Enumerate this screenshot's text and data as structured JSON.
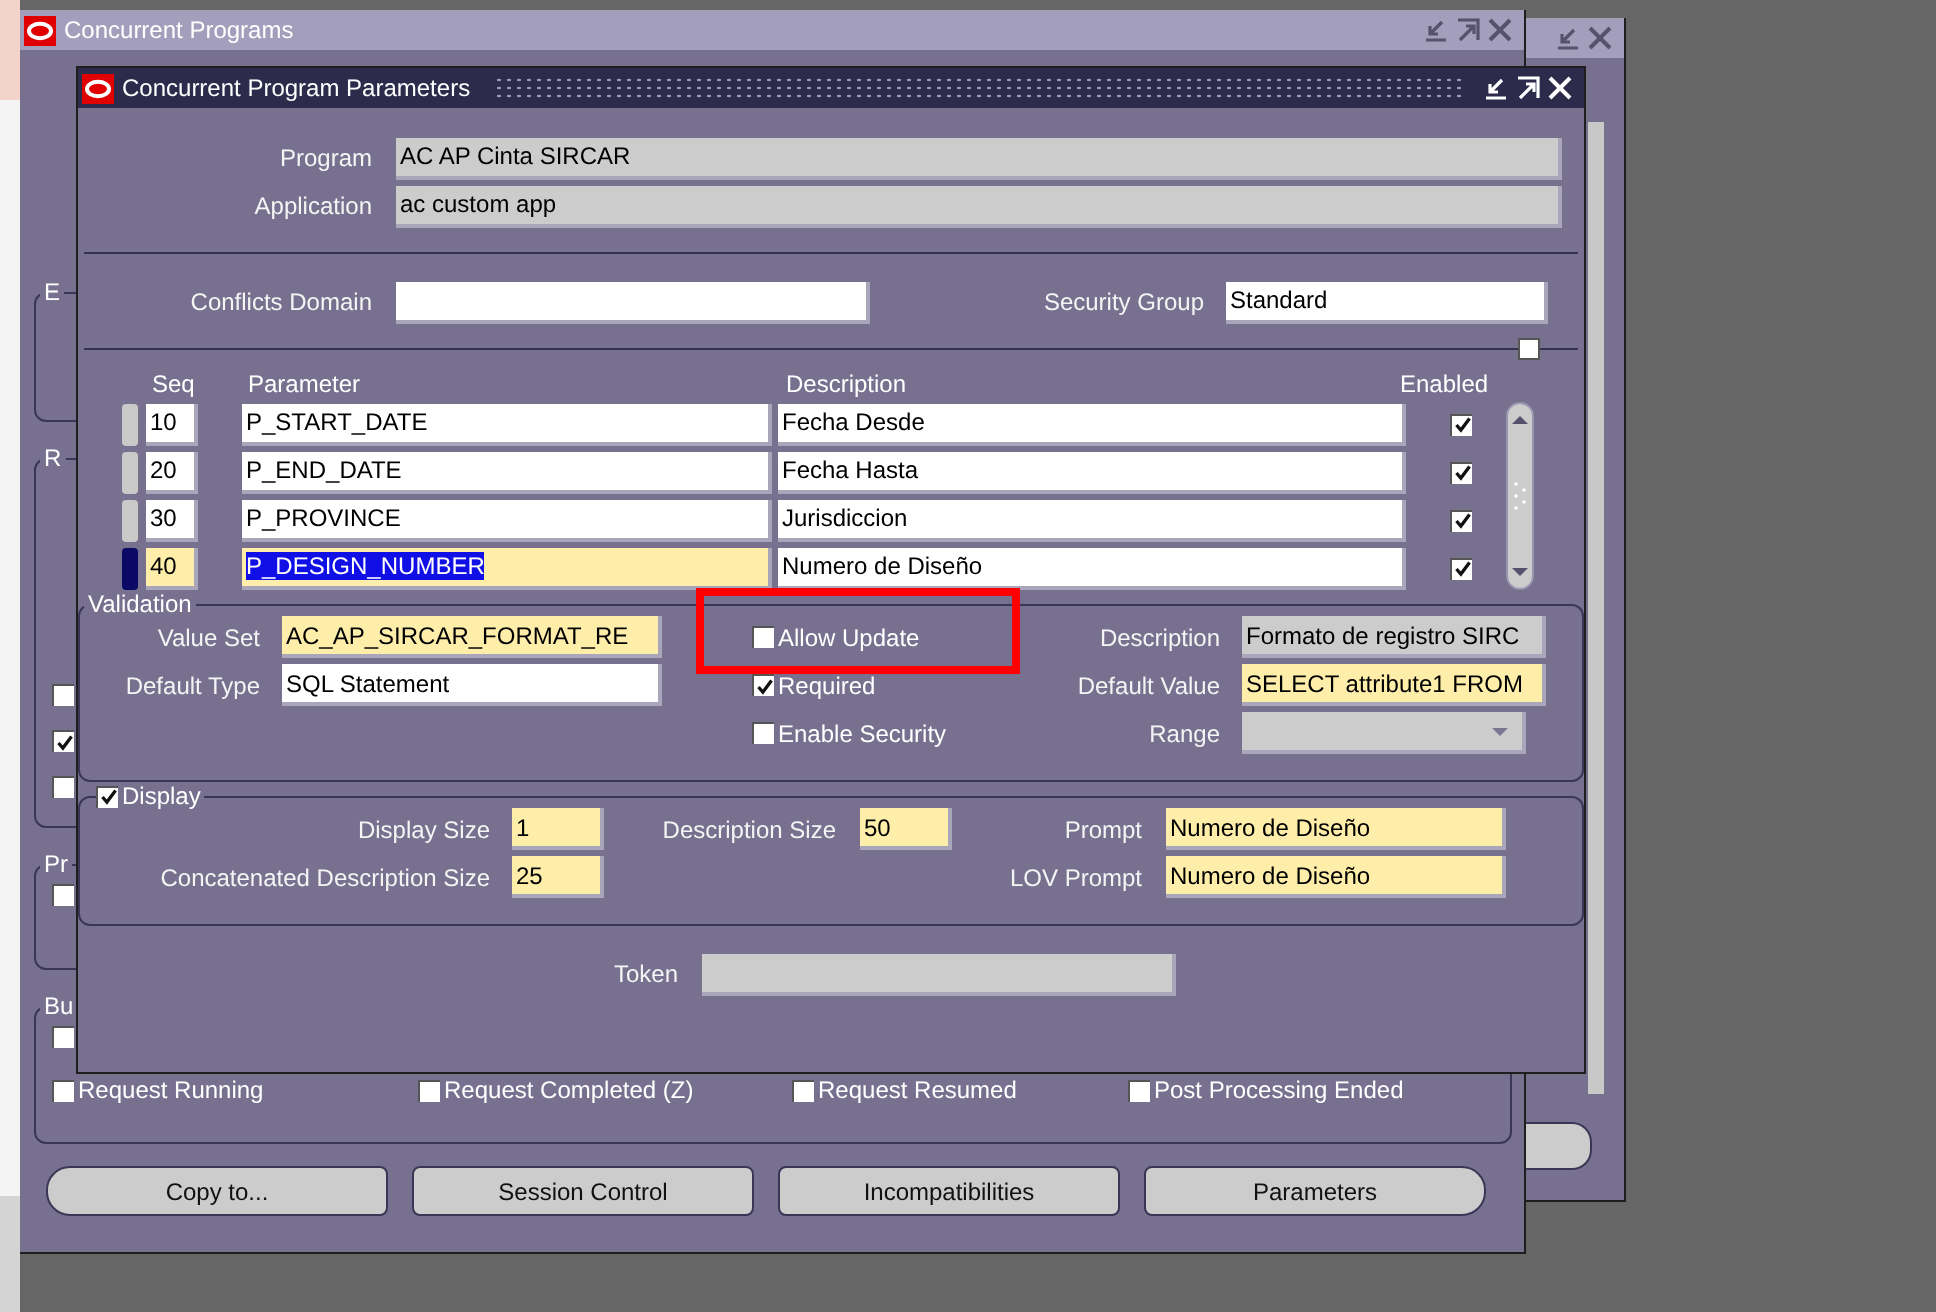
{
  "main_window": {
    "title": "Concurrent Programs",
    "groups": [
      {
        "label": "E"
      },
      {
        "label": "R",
        "checkboxes": [
          {
            "checked": false
          },
          {
            "checked": true
          },
          {
            "checked": false
          }
        ]
      },
      {
        "label": "Pr",
        "checkboxes": [
          {
            "checked": false
          }
        ]
      },
      {
        "label": "Bu",
        "checkboxes": [
          {
            "checked": false
          }
        ]
      }
    ],
    "options": [
      {
        "label": "Request Running",
        "checked": false
      },
      {
        "label": "Request Completed (Z)",
        "checked": false
      },
      {
        "label": "Request Resumed",
        "checked": false
      },
      {
        "label": "Post Processing Ended",
        "checked": false
      }
    ],
    "buttons": [
      "Copy to...",
      "Session Control",
      "Incompatibilities",
      "Parameters"
    ]
  },
  "dialog": {
    "title": "Concurrent Program Parameters",
    "header_fields": [
      {
        "label": "Program",
        "value": "AC AP Cinta SIRCAR",
        "kind": "display"
      },
      {
        "label": "Application",
        "value": "ac custom app",
        "kind": "display"
      }
    ],
    "conflicts_domain": {
      "label": "Conflicts Domain",
      "kind": "optional"
    },
    "security_group": {
      "label": "Security Group",
      "value": "Standard",
      "kind": "optional"
    },
    "table": {
      "columns": [
        "Seq",
        "Parameter",
        "Description",
        "Enabled"
      ],
      "rows": [
        {
          "seq": "10",
          "parameter": "P_START_DATE",
          "description": "Fecha Desde",
          "enabled": true,
          "selected": false
        },
        {
          "seq": "20",
          "parameter": "P_END_DATE",
          "description": "Fecha Hasta",
          "enabled": true,
          "selected": false
        },
        {
          "seq": "30",
          "parameter": "P_PROVINCE",
          "description": "Jurisdiccion",
          "enabled": true,
          "selected": false
        },
        {
          "seq": "40",
          "parameter": "P_DESIGN_NUMBER",
          "description": "Numero de Diseño",
          "enabled": true,
          "selected": true
        }
      ]
    },
    "validation": {
      "title": "Validation",
      "left_fields": [
        {
          "label": "Value Set",
          "value": "AC_AP_SIRCAR_FORMAT_RE",
          "kind": "required"
        },
        {
          "label": "Default Type",
          "value": "SQL Statement",
          "kind": "optional"
        }
      ],
      "checkboxes": [
        {
          "label": "Allow Update",
          "checked": false,
          "highlighted": true
        },
        {
          "label": "Required",
          "checked": true,
          "highlighted": false
        },
        {
          "label": "Enable Security",
          "checked": false,
          "highlighted": false
        }
      ],
      "right_fields": [
        {
          "label": "Description",
          "value": "Formato de registro SIRC",
          "kind": "display"
        },
        {
          "label": "Default Value",
          "value": "SELECT attribute1 FROM",
          "kind": "required"
        },
        {
          "label": "Range",
          "kind": "dropdown"
        }
      ]
    },
    "display": {
      "title": "Display",
      "checked": true,
      "fields": [
        {
          "label": "Display Size",
          "value": "1",
          "kind": "required"
        },
        {
          "label": "Description Size",
          "value": "50",
          "kind": "required"
        },
        {
          "label": "Prompt",
          "value": "Numero de Diseño",
          "kind": "required"
        },
        {
          "label": "Concatenated Description Size",
          "value": "25",
          "kind": "required"
        },
        {
          "label": "LOV Prompt",
          "value": "Numero de Diseño",
          "kind": "required"
        }
      ]
    },
    "token": {
      "label": "Token",
      "kind": "display"
    }
  }
}
